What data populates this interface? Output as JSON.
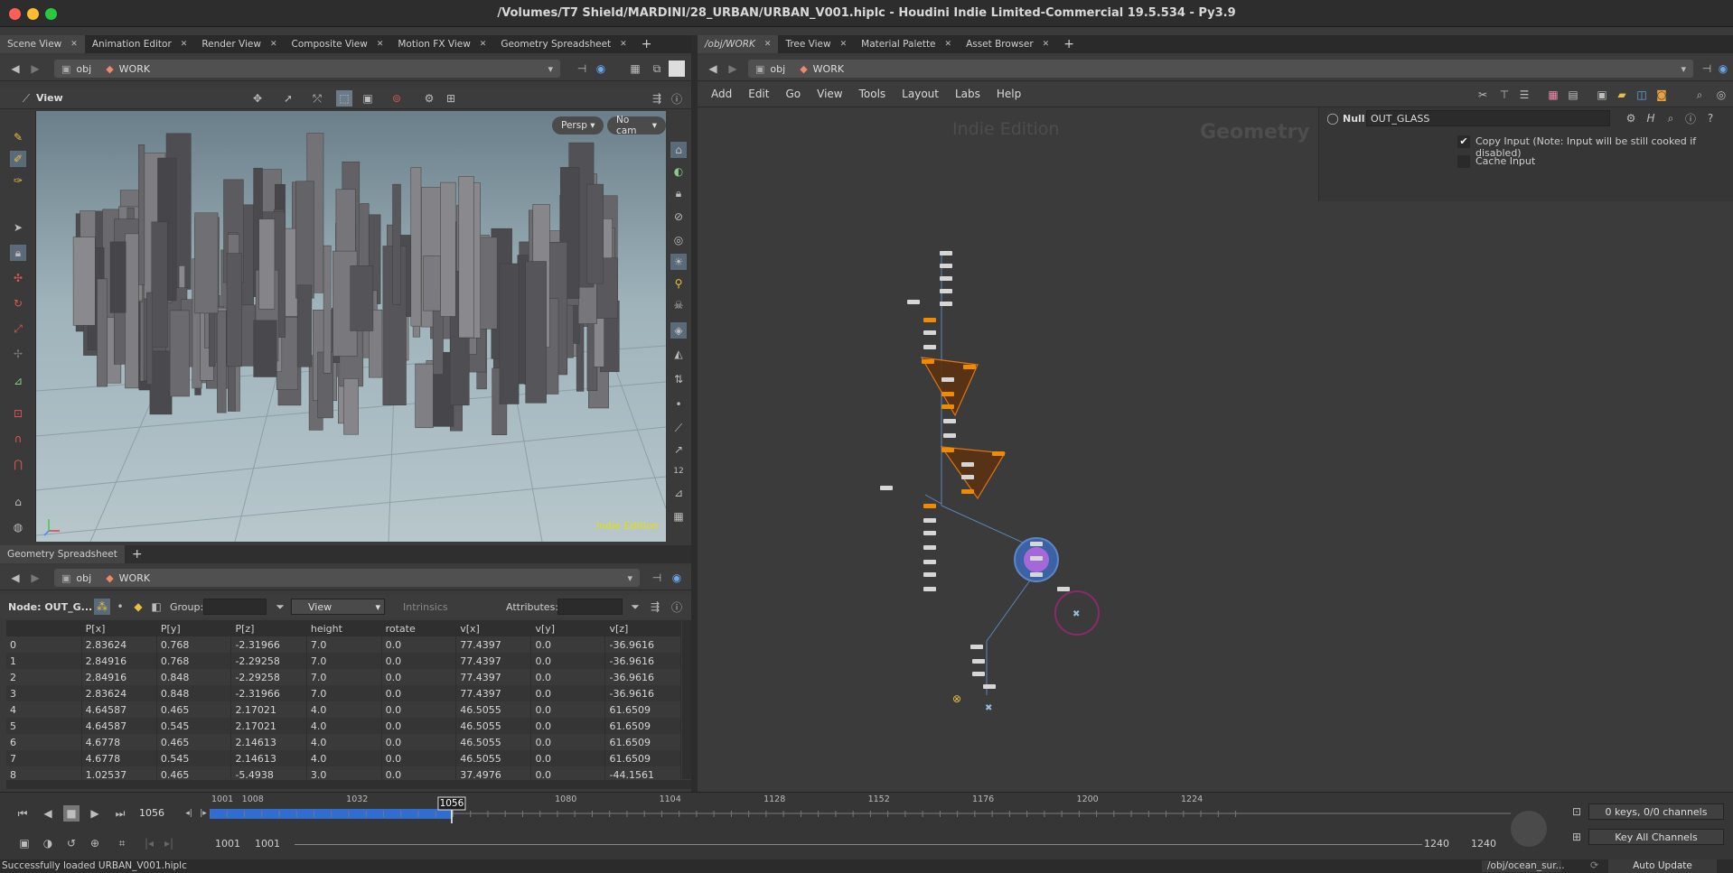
{
  "window": {
    "title": "/Volumes/T7 Shield/MARDINI/28_URBAN/URBAN_V001.hiplc - Houdini Indie Limited-Commercial 19.5.534 - Py3.9",
    "traffic_colors": [
      "#ff5f57",
      "#febc2e",
      "#28c840"
    ]
  },
  "left_tabs": {
    "items": [
      {
        "label": "Scene View"
      },
      {
        "label": "Animation Editor"
      },
      {
        "label": "Render View"
      },
      {
        "label": "Composite View"
      },
      {
        "label": "Motion FX View"
      },
      {
        "label": "Geometry Spreadsheet"
      }
    ]
  },
  "right_tabs": {
    "items": [
      {
        "label": "/obj/WORK"
      },
      {
        "label": "Tree View"
      },
      {
        "label": "Material Palette"
      },
      {
        "label": "Asset Browser"
      }
    ]
  },
  "path": {
    "obj": "obj",
    "work": "WORK"
  },
  "viewer": {
    "label": "View",
    "persp": "Persp",
    "cam": "No cam",
    "watermark": "Indie Edition"
  },
  "spreadsheet": {
    "tab_label": "Geometry Spreadsheet",
    "node_label": "Node: OUT_G...",
    "group_label": "Group:",
    "view_label": "View",
    "intrinsics_label": "Intrinsics",
    "attributes_label": "Attributes:",
    "columns": [
      "",
      "P[x]",
      "P[y]",
      "P[z]",
      "height",
      "rotate",
      "v[x]",
      "v[y]",
      "v[z]"
    ],
    "rows": [
      [
        "0",
        "2.83624",
        "0.768",
        "-2.31966",
        "7.0",
        "0.0",
        "77.4397",
        "0.0",
        "-36.9616"
      ],
      [
        "1",
        "2.84916",
        "0.768",
        "-2.29258",
        "7.0",
        "0.0",
        "77.4397",
        "0.0",
        "-36.9616"
      ],
      [
        "2",
        "2.84916",
        "0.848",
        "-2.29258",
        "7.0",
        "0.0",
        "77.4397",
        "0.0",
        "-36.9616"
      ],
      [
        "3",
        "2.83624",
        "0.848",
        "-2.31966",
        "7.0",
        "0.0",
        "77.4397",
        "0.0",
        "-36.9616"
      ],
      [
        "4",
        "4.64587",
        "0.465",
        "2.17021",
        "4.0",
        "0.0",
        "46.5055",
        "0.0",
        "61.6509"
      ],
      [
        "5",
        "4.64587",
        "0.545",
        "2.17021",
        "4.0",
        "0.0",
        "46.5055",
        "0.0",
        "61.6509"
      ],
      [
        "6",
        "4.6778",
        "0.465",
        "2.14613",
        "4.0",
        "0.0",
        "46.5055",
        "0.0",
        "61.6509"
      ],
      [
        "7",
        "4.6778",
        "0.545",
        "2.14613",
        "4.0",
        "0.0",
        "46.5055",
        "0.0",
        "61.6509"
      ],
      [
        "8",
        "1.02537",
        "0.465",
        "-5.4938",
        "3.0",
        "0.0",
        "37.4976",
        "0.0",
        "-44.1561"
      ]
    ]
  },
  "network": {
    "menu": [
      "Add",
      "Edit",
      "Go",
      "View",
      "Tools",
      "Layout",
      "Labs",
      "Help"
    ],
    "ghost_indie": "Indie Edition",
    "ghost_context": "Geometry"
  },
  "params": {
    "node_type": "Null",
    "node_name": "OUT_GLASS",
    "copy_input": "Copy Input (Note: Input will be still cooked if disabled)",
    "cache_input": "Cache Input"
  },
  "timeline": {
    "current_frame": "1056",
    "ticks": [
      "1001",
      "1008",
      "1032",
      "1080",
      "1104",
      "1128",
      "1152",
      "1176",
      "1200",
      "1224"
    ],
    "range_start": "1001",
    "range_start2": "1001",
    "range_end": "1240",
    "range_end2": "1240",
    "keys_label": "0 keys, 0/0 channels",
    "key_all": "Key All Channels",
    "playhead_progress": 0.233
  },
  "status": {
    "message": "Successfully loaded URBAN_V001.hiplc",
    "path": "/obj/ocean_sur...",
    "update": "Auto Update"
  }
}
